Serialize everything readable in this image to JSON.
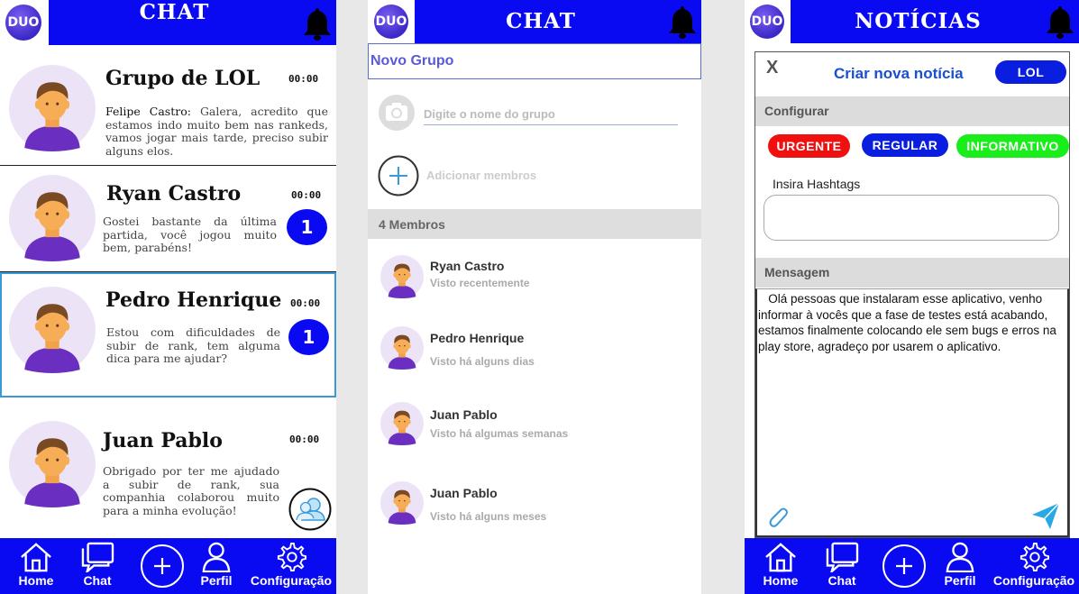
{
  "brand": {
    "logo_text": "DUO"
  },
  "panel1": {
    "title": "CHAT",
    "chats": [
      {
        "name": "Grupo de LOL",
        "time": "00:00",
        "sender": "Felipe Castro:",
        "message": " Galera, acredito que estamos indo muito bem nas rankeds, vamos jogar mais tarde, preciso subir alguns elos.",
        "badge": ""
      },
      {
        "name": "Ryan Castro",
        "time": "00:00",
        "sender": "",
        "message": "Gostei bastante da última partida, você jogou muito bem, parabéns!",
        "badge": "1"
      },
      {
        "name": "Pedro Henrique",
        "time": "00:00",
        "sender": "",
        "message": "Estou com dificuldades de subir de rank, tem alguma dica para me ajudar?",
        "badge": "1"
      },
      {
        "name": "Juan Pablo",
        "time": "00:00",
        "sender": "",
        "message": "Obrigado por ter me ajudado a subir de rank, sua companhia colaborou muito para a minha evolução!",
        "badge": ""
      }
    ]
  },
  "panel2": {
    "title": "CHAT",
    "new_group": "Novo Grupo",
    "group_name_placeholder": "Digite o nome do grupo",
    "add_members": "Adicionar membros",
    "members_header": "4 Membros",
    "members": [
      {
        "name": "Ryan Castro",
        "status": "Visto recentemente"
      },
      {
        "name": "Pedro Henrique",
        "status": "Visto há alguns dias"
      },
      {
        "name": "Juan Pablo",
        "status": "Visto há algumas semanas"
      },
      {
        "name": "Juan Pablo",
        "status": "Visto há alguns meses"
      }
    ]
  },
  "panel3": {
    "title": "NOTÍCIAS",
    "close": "X",
    "create_title": "Criar nova notícia",
    "group_tag": "LOL",
    "configure": "Configurar",
    "tags": [
      "URGENTE",
      "REGULAR",
      "INFORMATIVO"
    ],
    "tag_colors": [
      "#f01010",
      "#0a1ee0",
      "#1aee1a"
    ],
    "hashtags_label": "Insira Hashtags",
    "message_label": "Mensagem",
    "message": "   Olá pessoas que instalaram esse aplicativo, venho informar à vocês que a fase de testes está acabando, estamos finalmente colocando ele sem bugs e erros na play store, agradeço por usarem o aplicativo."
  },
  "nav": {
    "home": "Home",
    "chat": "Chat",
    "profile": "Perfil",
    "settings": "Configuração"
  },
  "colors": {
    "primary": "#0a0af2",
    "accent": "#3a9ad9",
    "avatar_bg": "#ece4f6",
    "shirt": "#6a2fc0"
  }
}
